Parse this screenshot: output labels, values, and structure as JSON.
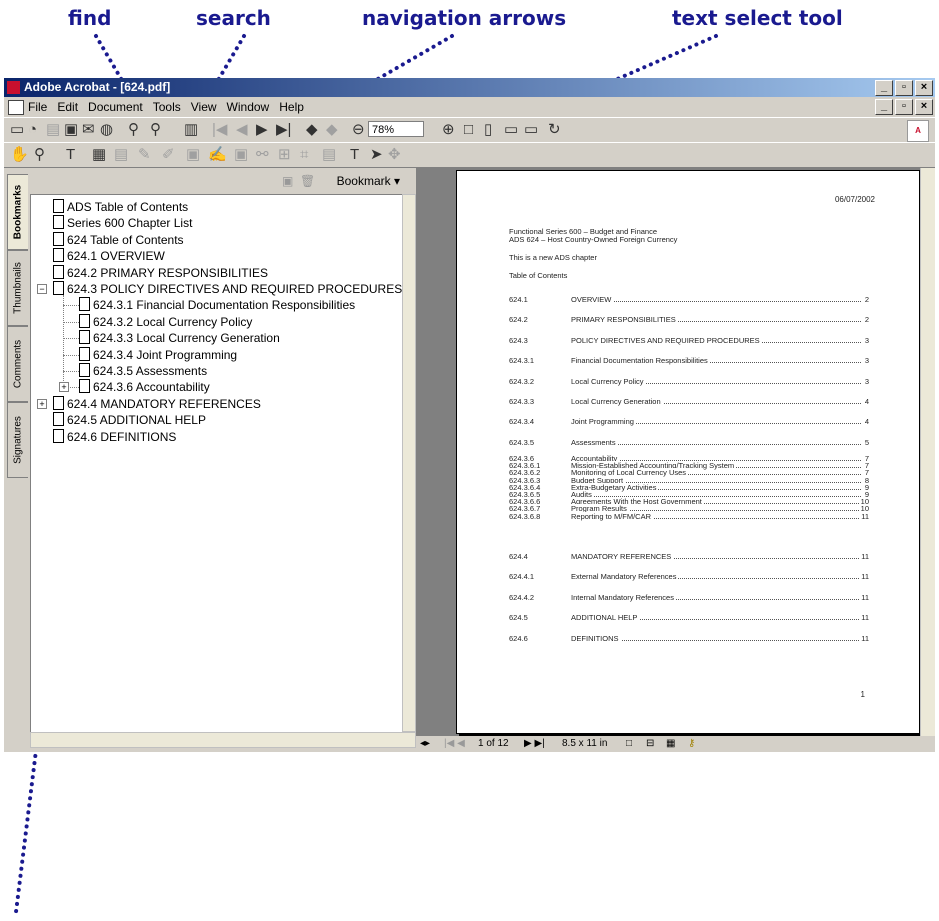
{
  "callouts": {
    "find": "find",
    "search": "search",
    "nav_arrows": "navigation arrows",
    "text_select": "text select tool"
  },
  "window": {
    "title": "Adobe Acrobat - [624.pdf]",
    "menu": [
      "File",
      "Edit",
      "Document",
      "Tools",
      "View",
      "Window",
      "Help"
    ],
    "zoom": "78%"
  },
  "side_tabs": [
    "Bookmarks",
    "Thumbnails",
    "Comments",
    "Signatures"
  ],
  "bookmark_pane": {
    "menu_label": "Bookmark",
    "items": [
      {
        "label": "ADS Table of Contents",
        "level": 0
      },
      {
        "label": "Series 600 Chapter List",
        "level": 0
      },
      {
        "label": "624 Table of Contents",
        "level": 0
      },
      {
        "label": "624.1 OVERVIEW",
        "level": 0
      },
      {
        "label": "624.2 PRIMARY RESPONSIBILITIES",
        "level": 0
      },
      {
        "label": "624.3 POLICY DIRECTIVES AND REQUIRED PROCEDURES",
        "level": 0
      },
      {
        "label": "624.3.1 Financial Documentation Responsibilities",
        "level": 1
      },
      {
        "label": "624.3.2 Local Currency Policy",
        "level": 1
      },
      {
        "label": "624.3.3 Local Currency Generation",
        "level": 1
      },
      {
        "label": "624.3.4 Joint Programming",
        "level": 1
      },
      {
        "label": "624.3.5 Assessments",
        "level": 1
      },
      {
        "label": "624.3.6 Accountability",
        "level": 1
      },
      {
        "label": "624.4 MANDATORY REFERENCES",
        "level": 0
      },
      {
        "label": "624.5 ADDITIONAL HELP",
        "level": 0
      },
      {
        "label": "624.6 DEFINITIONS",
        "level": 0
      }
    ]
  },
  "document": {
    "date": "06/07/2002",
    "heading1": "Functional Series 600 – Budget and Finance",
    "heading2": "ADS 624 – Host Country-Owned Foreign Currency",
    "note": "This is a new ADS chapter",
    "toc_title": "Table of Contents",
    "toc": [
      {
        "num": "624.1",
        "title": "OVERVIEW",
        "page": "2"
      },
      {
        "num": "624.2",
        "title": "PRIMARY RESPONSIBILITIES",
        "page": "2"
      },
      {
        "num": "624.3",
        "title": "POLICY DIRECTIVES AND REQUIRED PROCEDURES",
        "page": "3"
      },
      {
        "num": "624.3.1",
        "title": "Financial Documentation Responsibilities",
        "page": "3"
      },
      {
        "num": "624.3.2",
        "title": "Local Currency Policy",
        "page": "3"
      },
      {
        "num": "624.3.3",
        "title": "Local Currency Generation",
        "page": "4"
      },
      {
        "num": "624.3.4",
        "title": "Joint Programming",
        "page": "4"
      },
      {
        "num": "624.3.5",
        "title": "Assessments",
        "page": "5"
      }
    ],
    "toc_dense": [
      {
        "num": "624.3.6",
        "title": "Accountability",
        "page": "7"
      },
      {
        "num": "624.3.6.1",
        "title": "Mission-Established Accounting/Tracking System",
        "page": "7"
      },
      {
        "num": "624.3.6.2",
        "title": "Monitoring of Local Currency Uses",
        "page": "7"
      },
      {
        "num": "624.3.6.3",
        "title": "Budget Support",
        "page": "8"
      },
      {
        "num": "624.3.6.4",
        "title": "Extra-Budgetary Activities",
        "page": "9"
      },
      {
        "num": "624.3.6.5",
        "title": "Audits",
        "page": "9"
      },
      {
        "num": "624.3.6.6",
        "title": "Agreements With the Host Government",
        "page": "10"
      },
      {
        "num": "624.3.6.7",
        "title": "Program Results",
        "page": "10"
      },
      {
        "num": "624.3.6.8",
        "title": "Reporting to M/FM/CAR",
        "page": "11"
      }
    ],
    "toc_end": [
      {
        "num": "624.4",
        "title": "MANDATORY REFERENCES",
        "page": "11"
      },
      {
        "num": "624.4.1",
        "title": "External Mandatory References",
        "page": "11"
      },
      {
        "num": "624.4.2",
        "title": "Internal Mandatory References",
        "page": "11"
      },
      {
        "num": "624.5",
        "title": "ADDITIONAL HELP",
        "page": "11"
      },
      {
        "num": "624.6",
        "title": "DEFINITIONS",
        "page": "11"
      }
    ],
    "page_number": "1"
  },
  "status_bar": {
    "page_of": "1 of 12",
    "page_size": "8.5 x 11 in"
  }
}
